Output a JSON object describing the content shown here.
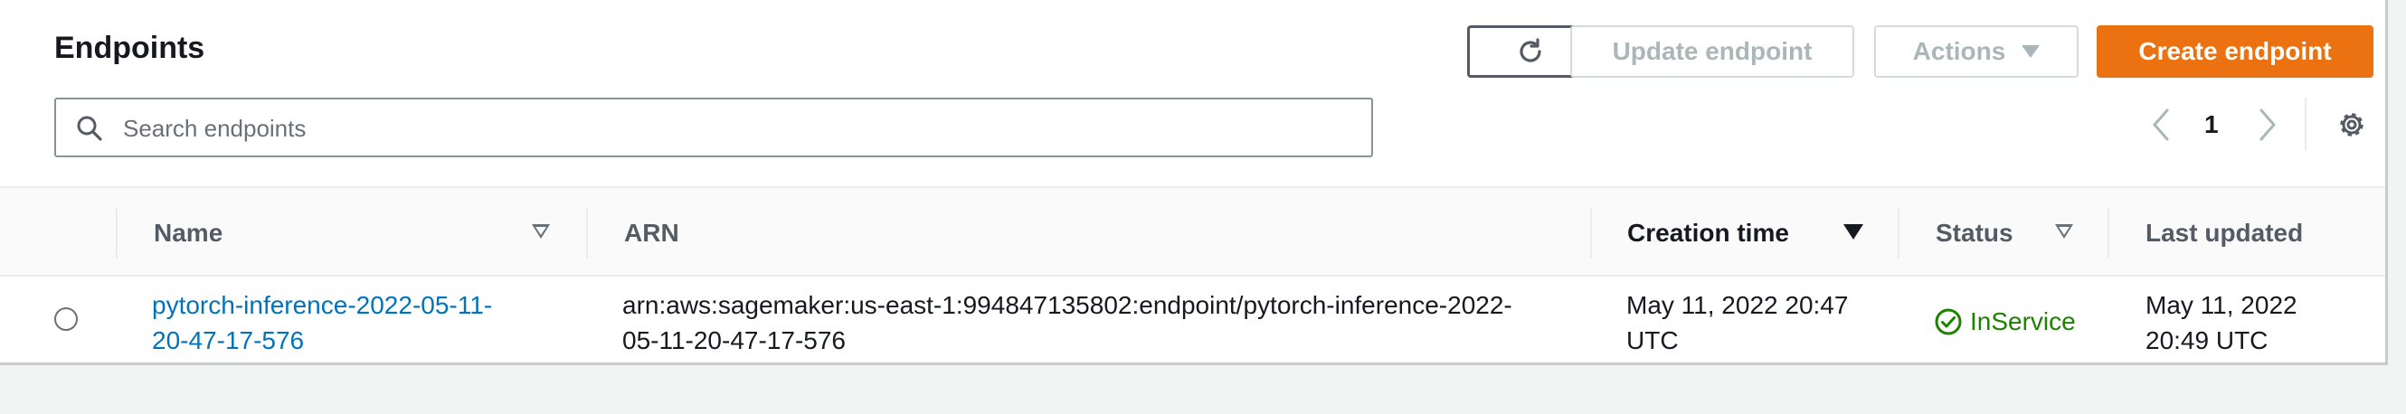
{
  "header": {
    "title": "Endpoints",
    "update_label": "Update endpoint",
    "actions_label": "Actions",
    "create_label": "Create endpoint"
  },
  "search": {
    "placeholder": "Search endpoints"
  },
  "pagination": {
    "current_page": "1"
  },
  "table": {
    "columns": [
      "Name",
      "ARN",
      "Creation time",
      "Status",
      "Last updated"
    ],
    "rows": [
      {
        "name_line1": "pytorch-inference-2022-05-11-",
        "name_line2": "20-47-17-576",
        "arn_line1": "arn:aws:sagemaker:us-east-1:994847135802:endpoint/pytorch-inference-2022-",
        "arn_line2": "05-11-20-47-17-576",
        "created_line1": "May 11, 2022 20:47",
        "created_line2": "UTC",
        "status": "InService",
        "updated_line1": "May 11, 2022",
        "updated_line2": "20:49 UTC"
      }
    ]
  },
  "colors": {
    "primary": "#ec7211",
    "link": "#0073bb",
    "success": "#1d8102"
  }
}
